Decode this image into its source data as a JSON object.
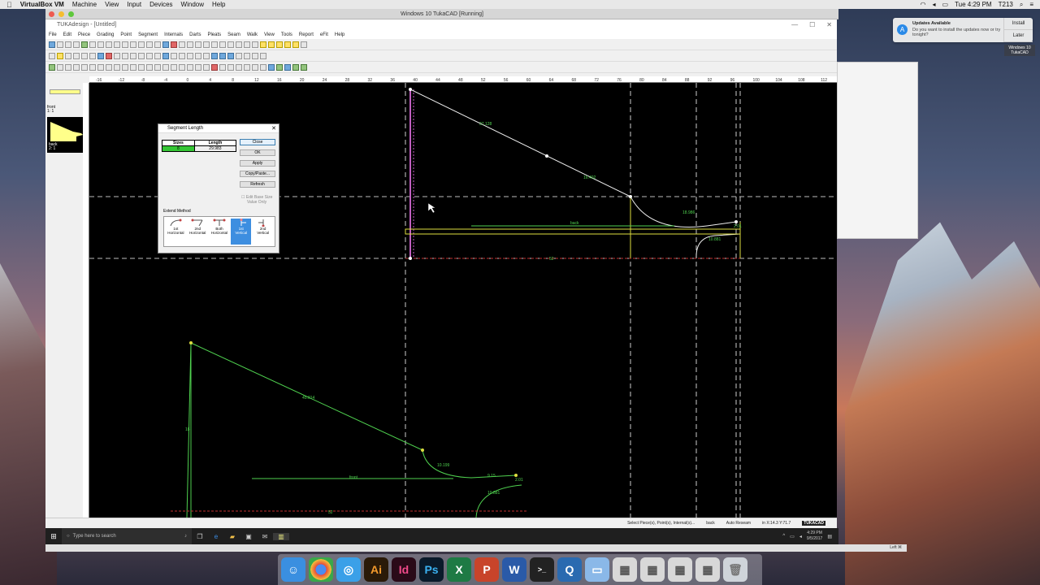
{
  "mac_menubar": {
    "apple": "",
    "items": [
      "VirtualBox VM",
      "Machine",
      "View",
      "Input",
      "Devices",
      "Window",
      "Help"
    ],
    "status_clock": "Tue 4:29 PM",
    "status_user": "T213"
  },
  "vm_window_title": "Windows 10 TukaCAD [Running]",
  "app": {
    "title": "TUKAdesign - [Untitled]",
    "menu": [
      "File",
      "Edit",
      "Piece",
      "Grading",
      "Point",
      "Segment",
      "Internals",
      "Darts",
      "Pleats",
      "Seam",
      "Walk",
      "View",
      "Tools",
      "Report",
      "eFit",
      "Help"
    ],
    "panel_front_label": "front",
    "panel_front_sub": "1: 1",
    "panel_back_label": "back",
    "panel_back_sub": "2: 1"
  },
  "ruler_ticks": [
    "-16",
    "-12",
    "-8",
    "-4",
    "0",
    "4",
    "8",
    "12",
    "16",
    "20",
    "24",
    "28",
    "32",
    "36",
    "40",
    "44",
    "48",
    "52",
    "56",
    "60",
    "64",
    "68",
    "72",
    "76",
    "80",
    "84",
    "88",
    "92",
    "96",
    "100",
    "104",
    "108",
    "112"
  ],
  "canvas": {
    "back_label": "back",
    "front_label": "front",
    "labels": {
      "b1": "27.128",
      "b2": "16.402",
      "b3": "18.986",
      "b4": "10.881",
      "b5": "2.01",
      "b6": "52",
      "f1": "45.014",
      "f2": "10.199",
      "f3": "9.15",
      "f4": "2.01",
      "f5": "10.881",
      "f6": "52",
      "f7": "18"
    }
  },
  "dialog": {
    "title": "Segment Length",
    "col_sizes": "Sizes",
    "col_length": "Length",
    "row_size": "8",
    "row_length": "29.983",
    "close": "Close",
    "ok": "OK",
    "apply": "Apply",
    "copy_paste": "Copy/Paste...",
    "refresh": "Refresh",
    "edit_base_1": "Edit Base Size",
    "edit_base_2": "Value Only",
    "extend_method": "Extend Method",
    "methods": [
      {
        "l1": "1st",
        "l2": "Horizontal"
      },
      {
        "l1": "2nd",
        "l2": "Horizontal"
      },
      {
        "l1": "Both",
        "l2": "Horizontal"
      },
      {
        "l1": "1st",
        "l2": "Vertical"
      },
      {
        "l1": "2nd",
        "l2": "Vertical"
      }
    ]
  },
  "status": {
    "prompt": "Select Piece(s), Point(s), Internal(s)...",
    "piece": "back",
    "mode": "Auto Reseam",
    "coords": "in  X:14.3  Y:71.7",
    "brand": "TUKACAD"
  },
  "notification": {
    "title": "Updates Available",
    "body": "Do you want to install the updates now or try tonight?",
    "install": "Install",
    "later": "Later"
  },
  "desktop_icon": "Windows 10 TukaCAD",
  "taskbar": {
    "search_placeholder": "Type here to search",
    "time": "4:29 PM",
    "date": "9/5/2017"
  },
  "vb_status": "Left ⌘",
  "colors": {
    "canvas_bg": "#000000",
    "pattern_green": "#4fd14f",
    "selected_segment": "#c060c0",
    "guide_line": "#cccccc",
    "dialog_highlight": "#35c635",
    "accent_blue": "#3d8ee0"
  }
}
